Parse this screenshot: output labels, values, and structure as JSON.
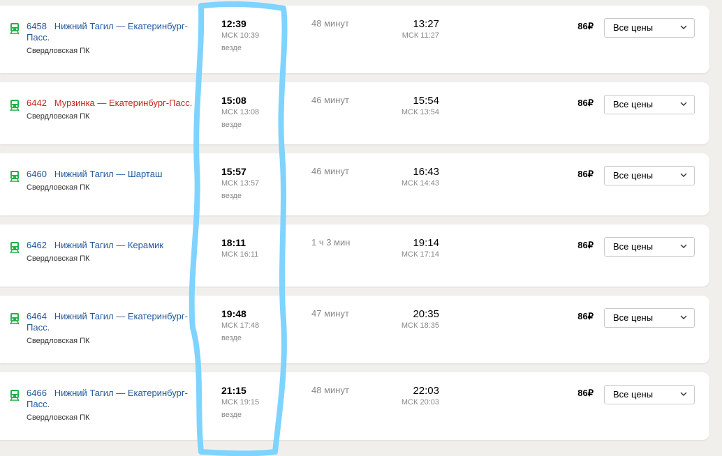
{
  "colors": {
    "background": "#f0efec",
    "link": "#21579c",
    "highlight_route": "#c2261d",
    "train_icon": "#22b14c",
    "annotation_stroke": "#7fd3ff"
  },
  "rows": [
    {
      "number": "6458",
      "route": "Нижний Тагил — Екатеринбург-Пасс.",
      "carrier": "Свердловская ПК",
      "dep_time": "12:39",
      "dep_msk": "МСК 10:39",
      "dep_where": "везде",
      "duration": "48 минут",
      "arr_time": "13:27",
      "arr_msk": "МСК 11:27",
      "price": "86₽",
      "select_label": "Все цены",
      "highlight": false
    },
    {
      "number": "6442",
      "route": "Мурзинка — Екатеринбург-Пасс.",
      "carrier": "Свердловская ПК",
      "dep_time": "15:08",
      "dep_msk": "МСК 13:08",
      "dep_where": "везде",
      "duration": "46 минут",
      "arr_time": "15:54",
      "arr_msk": "МСК 13:54",
      "price": "86₽",
      "select_label": "Все цены",
      "highlight": true
    },
    {
      "number": "6460",
      "route": "Нижний Тагил — Шарташ",
      "carrier": "Свердловская ПК",
      "dep_time": "15:57",
      "dep_msk": "МСК 13:57",
      "dep_where": "везде",
      "duration": "46 минут",
      "arr_time": "16:43",
      "arr_msk": "МСК 14:43",
      "price": "86₽",
      "select_label": "Все цены",
      "highlight": false
    },
    {
      "number": "6462",
      "route": "Нижний Тагил — Керамик",
      "carrier": "Свердловская ПК",
      "dep_time": "18:11",
      "dep_msk": "МСК 16:11",
      "dep_where": "",
      "duration": "1 ч 3 мин",
      "arr_time": "19:14",
      "arr_msk": "МСК 17:14",
      "price": "86₽",
      "select_label": "Все цены",
      "highlight": false
    },
    {
      "number": "6464",
      "route": "Нижний Тагил — Екатеринбург-Пасс.",
      "carrier": "Свердловская ПК",
      "dep_time": "19:48",
      "dep_msk": "МСК 17:48",
      "dep_where": "везде",
      "duration": "47 минут",
      "arr_time": "20:35",
      "arr_msk": "МСК 18:35",
      "price": "86₽",
      "select_label": "Все цены",
      "highlight": false
    },
    {
      "number": "6466",
      "route": "Нижний Тагил — Екатеринбург-Пасс.",
      "carrier": "Свердловская ПК",
      "dep_time": "21:15",
      "dep_msk": "МСК 19:15",
      "dep_where": "везде",
      "duration": "48 минут",
      "arr_time": "22:03",
      "arr_msk": "МСК 20:03",
      "price": "86₽",
      "select_label": "Все цены",
      "highlight": false
    }
  ]
}
